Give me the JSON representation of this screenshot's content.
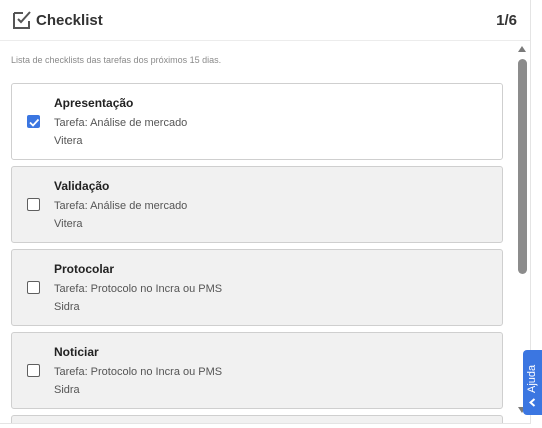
{
  "header": {
    "title": "Checklist",
    "count": "1/6",
    "icon": "checklist-icon"
  },
  "subtitle": "Lista de checklists das tarefas dos próximos 15 dias.",
  "items": [
    {
      "title": "Apresentação",
      "task": "Tarefa: Análise de mercado",
      "project": "Vitera",
      "checked": true
    },
    {
      "title": "Validação",
      "task": "Tarefa: Análise de mercado",
      "project": "Vitera",
      "checked": false
    },
    {
      "title": "Protocolar",
      "task": "Tarefa: Protocolo no Incra ou PMS",
      "project": "Sidra",
      "checked": false
    },
    {
      "title": "Noticiar",
      "task": "Tarefa: Protocolo no Incra ou PMS",
      "project": "Sidra",
      "checked": false
    }
  ],
  "help": {
    "label": "Ajuda",
    "icon": "chevron-left-icon"
  },
  "colors": {
    "accent": "#3b76e1",
    "card_background": "#f1f1f1",
    "card_border": "#cfcfcf"
  }
}
